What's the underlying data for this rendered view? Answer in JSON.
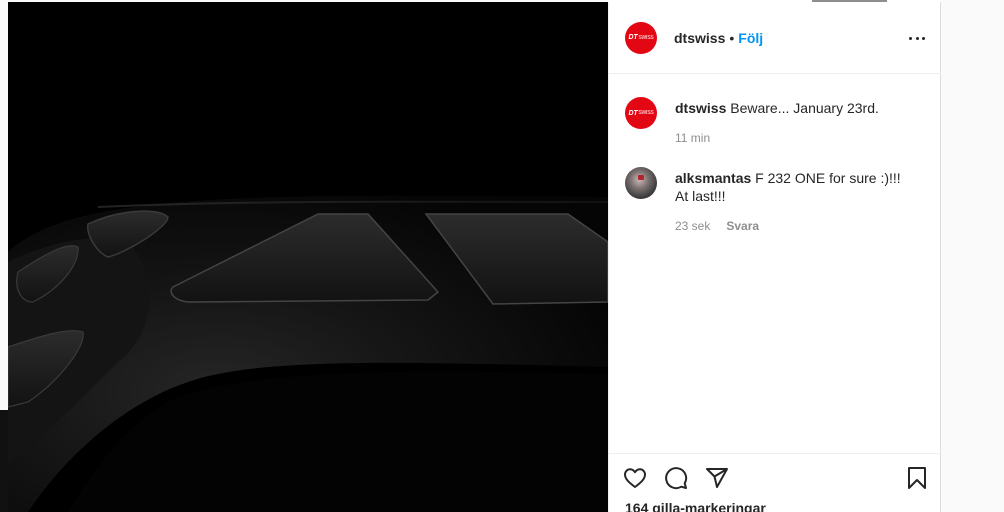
{
  "post": {
    "author": "dtswiss",
    "author_avatar_text": "DT",
    "author_avatar_subtext": "SWISS",
    "separator": "•",
    "follow_label": "Följ",
    "caption": {
      "username": "dtswiss",
      "text": "Beware... January 23rd.",
      "time": "11 min"
    },
    "comments": [
      {
        "username": "alksmantas",
        "text": "F 232 ONE for sure :)!!! At last!!!",
        "time": "23 sek",
        "reply_label": "Svara"
      }
    ],
    "likes": "164 gilla-markeringar"
  },
  "icons": {
    "more": "more-options-icon",
    "like": "heart-icon",
    "comment": "comment-icon",
    "share": "share-icon",
    "save": "bookmark-icon"
  },
  "colors": {
    "brand_red": "#e30613",
    "follow_blue": "#0095f6",
    "meta_grey": "#8e8e8e"
  }
}
